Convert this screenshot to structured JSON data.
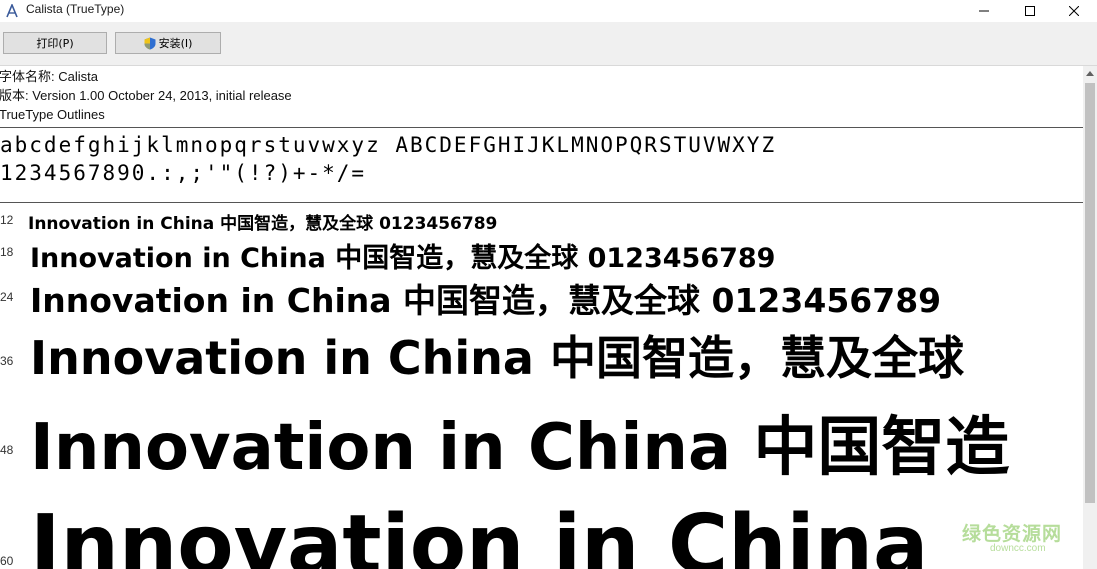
{
  "window": {
    "title": "Calista (TrueType)",
    "icon": "font-file-icon"
  },
  "toolbar": {
    "print_label": "打印(P)",
    "install_label": "安装(I)"
  },
  "info": {
    "font_name": "字体名称: Calista",
    "version": "版本: Version 1.00 October 24, 2013, initial release",
    "outline": "TrueType Outlines"
  },
  "charset": {
    "row1": "abcdefghijklmnopqrstuvwxyz ABCDEFGHIJKLMNOPQRSTUVWXYZ",
    "row2": "1234567890.:,;'\"(!?)+-*/="
  },
  "samples": [
    {
      "size": "12",
      "text": "Innovation in China 中国智造，慧及全球 0123456789"
    },
    {
      "size": "18",
      "text": "Innovation in China 中国智造，慧及全球 0123456789"
    },
    {
      "size": "24",
      "text": "Innovation in China 中国智造，慧及全球 0123456789"
    },
    {
      "size": "36",
      "text": "Innovation in China 中国智造，慧及全球"
    },
    {
      "size": "48",
      "text": "Innovation in China 中国智造"
    },
    {
      "size": "60",
      "text": "Innovation in China"
    }
  ],
  "watermark": {
    "main": "绿色资源网",
    "sub": "downcc.com"
  },
  "colors": {
    "titlebar_bg": "#ffffff",
    "toolbar_bg": "#f0f0f0",
    "watermark": "#7cc24a"
  }
}
